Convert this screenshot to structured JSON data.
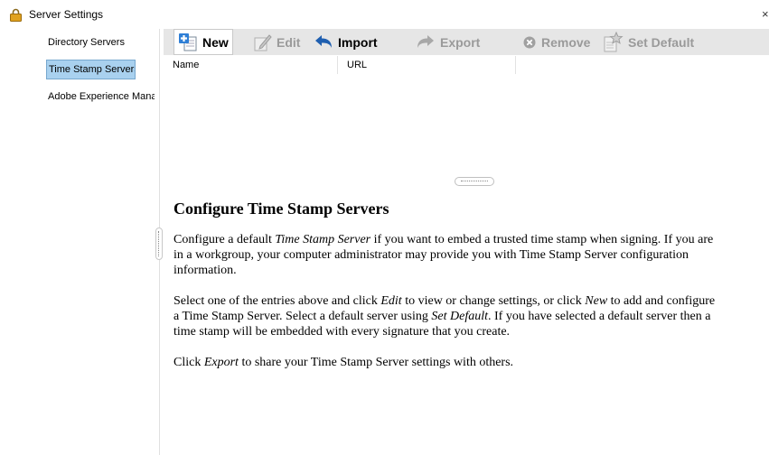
{
  "window": {
    "title": "Server Settings",
    "close_glyph": "×"
  },
  "sidebar": {
    "items": [
      {
        "label": "Directory Servers",
        "selected": false
      },
      {
        "label": "Time Stamp Servers",
        "selected": true
      },
      {
        "label": "Adobe Experience Manager",
        "selected": false
      }
    ]
  },
  "toolbar": {
    "new_label": "New",
    "edit_label": "Edit",
    "import_label": "Import",
    "export_label": "Export",
    "remove_label": "Remove",
    "set_default_label": "Set Default"
  },
  "table": {
    "columns": [
      "Name",
      "URL"
    ],
    "rows": []
  },
  "help": {
    "heading": "Configure Time Stamp Servers",
    "p1": {
      "l1a": "Configure a default ",
      "l1i": "Time Stamp Server",
      "l1b": " if you want to embed a trusted time stamp when signing. If you are",
      "l2": "in a workgroup, your computer administrator may provide you with Time Stamp Server configuration",
      "l3": "information."
    },
    "p2": {
      "l1a": "Select one of the entries above and click ",
      "l1i1": "Edit",
      "l1b": " to view or change settings, or click ",
      "l1i2": "New",
      "l1c": " to add and configure",
      "l2a": "a Time Stamp Server. Select a default server using ",
      "l2i": "Set Default",
      "l2b": ". If you have selected a default server then a",
      "l3": "time stamp will be embedded with every signature that you create."
    },
    "p3": {
      "a": "Click ",
      "i": "Export",
      "b": " to share your Time Stamp Server settings with others."
    }
  },
  "colors": {
    "selection_bg": "#a9d1ef",
    "toolbar_bg": "#e6e6e6",
    "disabled_text": "#9a9a9a"
  }
}
